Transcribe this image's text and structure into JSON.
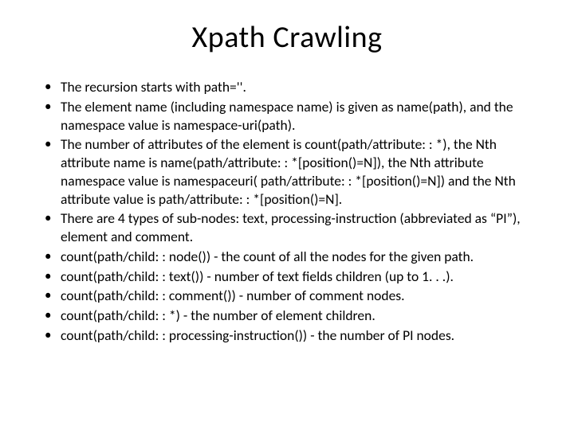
{
  "title": "Xpath Crawling",
  "bullets": [
    "The recursion starts with path=''.",
    "The element name (including namespace name) is given as name(path), and the namespace value is namespace-uri(path).",
    "The number of attributes of the element is count(path/attribute: : *), the Nth attribute name is name(path/attribute: : *[position()=N]), the Nth attribute namespace value is namespaceuri( path/attribute: : *[position()=N]) and the Nth attribute value is path/attribute: : *[position()=N].",
    "There are 4 types of sub-nodes: text, processing-instruction (abbreviated as “PI”), element and comment.",
    "count(path/child: : node()) - the count of all the nodes for the given path.",
    "count(path/child: : text()) - number of text fields children (up to 1. . .).",
    "count(path/child: : comment()) - number of comment nodes.",
    "count(path/child: : *) - the number of element children.",
    "count(path/child: : processing-instruction()) - the number of PI nodes."
  ]
}
